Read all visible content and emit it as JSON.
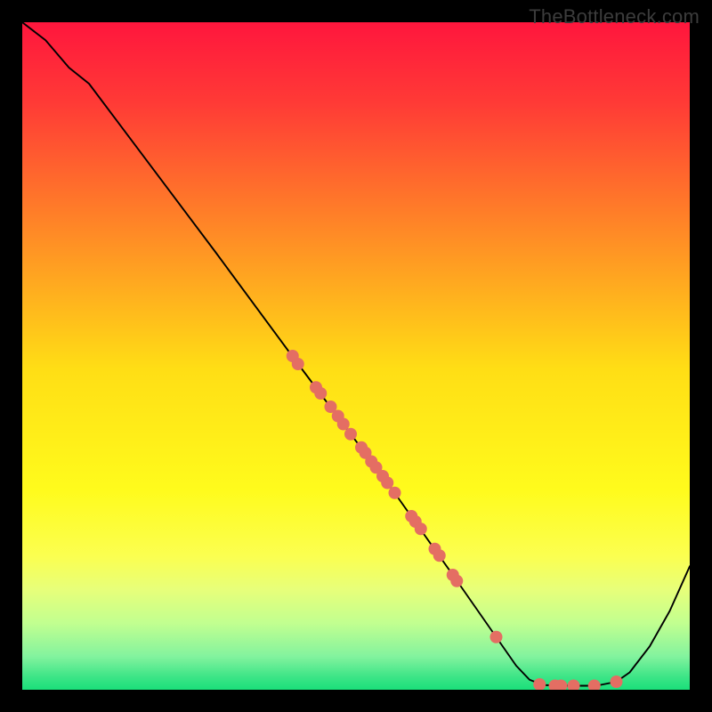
{
  "watermark": "TheBottleneck.com",
  "chart_data": {
    "type": "line",
    "title": "",
    "xlabel": "",
    "ylabel": "",
    "xlim": [
      0,
      100
    ],
    "ylim": [
      0,
      100
    ],
    "grid": false,
    "legend": false,
    "plot_background": "gradient",
    "gradient_stops": [
      {
        "pos": 0.0,
        "color": "#ff163d"
      },
      {
        "pos": 0.12,
        "color": "#ff3a36"
      },
      {
        "pos": 0.52,
        "color": "#ffde15"
      },
      {
        "pos": 0.7,
        "color": "#fffb1c"
      },
      {
        "pos": 0.8,
        "color": "#fbff50"
      },
      {
        "pos": 0.85,
        "color": "#e7ff7a"
      },
      {
        "pos": 0.9,
        "color": "#c2ff90"
      },
      {
        "pos": 0.95,
        "color": "#83f39e"
      },
      {
        "pos": 0.98,
        "color": "#3ee587"
      },
      {
        "pos": 1.0,
        "color": "#1adf7a"
      }
    ],
    "series": [
      {
        "name": "bottleneck-curve",
        "stroke": "#000000",
        "stroke_width": 1.9,
        "points": [
          {
            "x": 0.0,
            "y": 100.0
          },
          {
            "x": 3.5,
            "y": 97.3
          },
          {
            "x": 7.0,
            "y": 93.2
          },
          {
            "x": 10.0,
            "y": 90.8
          },
          {
            "x": 29.0,
            "y": 65.5
          },
          {
            "x": 40.8,
            "y": 49.5
          },
          {
            "x": 55.0,
            "y": 30.6
          },
          {
            "x": 65.0,
            "y": 16.5
          },
          {
            "x": 71.0,
            "y": 7.9
          },
          {
            "x": 74.0,
            "y": 3.6
          },
          {
            "x": 76.0,
            "y": 1.5
          },
          {
            "x": 78.0,
            "y": 0.7
          },
          {
            "x": 82.0,
            "y": 0.6
          },
          {
            "x": 86.0,
            "y": 0.6
          },
          {
            "x": 89.0,
            "y": 1.2
          },
          {
            "x": 91.0,
            "y": 2.6
          },
          {
            "x": 94.0,
            "y": 6.5
          },
          {
            "x": 97.0,
            "y": 11.8
          },
          {
            "x": 100.0,
            "y": 18.5
          }
        ]
      }
    ],
    "scatter": {
      "name": "markers",
      "color": "#e46e63",
      "radius": 7,
      "points": [
        {
          "x": 40.5,
          "y": 50.0
        },
        {
          "x": 41.3,
          "y": 48.8
        },
        {
          "x": 44.0,
          "y": 45.3
        },
        {
          "x": 44.7,
          "y": 44.4
        },
        {
          "x": 46.2,
          "y": 42.4
        },
        {
          "x": 47.3,
          "y": 41.0
        },
        {
          "x": 48.1,
          "y": 39.8
        },
        {
          "x": 49.2,
          "y": 38.3
        },
        {
          "x": 50.8,
          "y": 36.3
        },
        {
          "x": 51.4,
          "y": 35.5
        },
        {
          "x": 52.3,
          "y": 34.2
        },
        {
          "x": 53.0,
          "y": 33.3
        },
        {
          "x": 54.0,
          "y": 32.0
        },
        {
          "x": 54.7,
          "y": 31.0
        },
        {
          "x": 55.8,
          "y": 29.5
        },
        {
          "x": 58.3,
          "y": 26.0
        },
        {
          "x": 58.9,
          "y": 25.2
        },
        {
          "x": 59.7,
          "y": 24.1
        },
        {
          "x": 61.8,
          "y": 21.1
        },
        {
          "x": 62.5,
          "y": 20.1
        },
        {
          "x": 64.5,
          "y": 17.2
        },
        {
          "x": 65.1,
          "y": 16.3
        },
        {
          "x": 71.0,
          "y": 7.9
        },
        {
          "x": 77.5,
          "y": 0.8
        },
        {
          "x": 79.8,
          "y": 0.6
        },
        {
          "x": 80.7,
          "y": 0.6
        },
        {
          "x": 82.6,
          "y": 0.6
        },
        {
          "x": 85.7,
          "y": 0.6
        },
        {
          "x": 89.0,
          "y": 1.2
        }
      ]
    }
  }
}
